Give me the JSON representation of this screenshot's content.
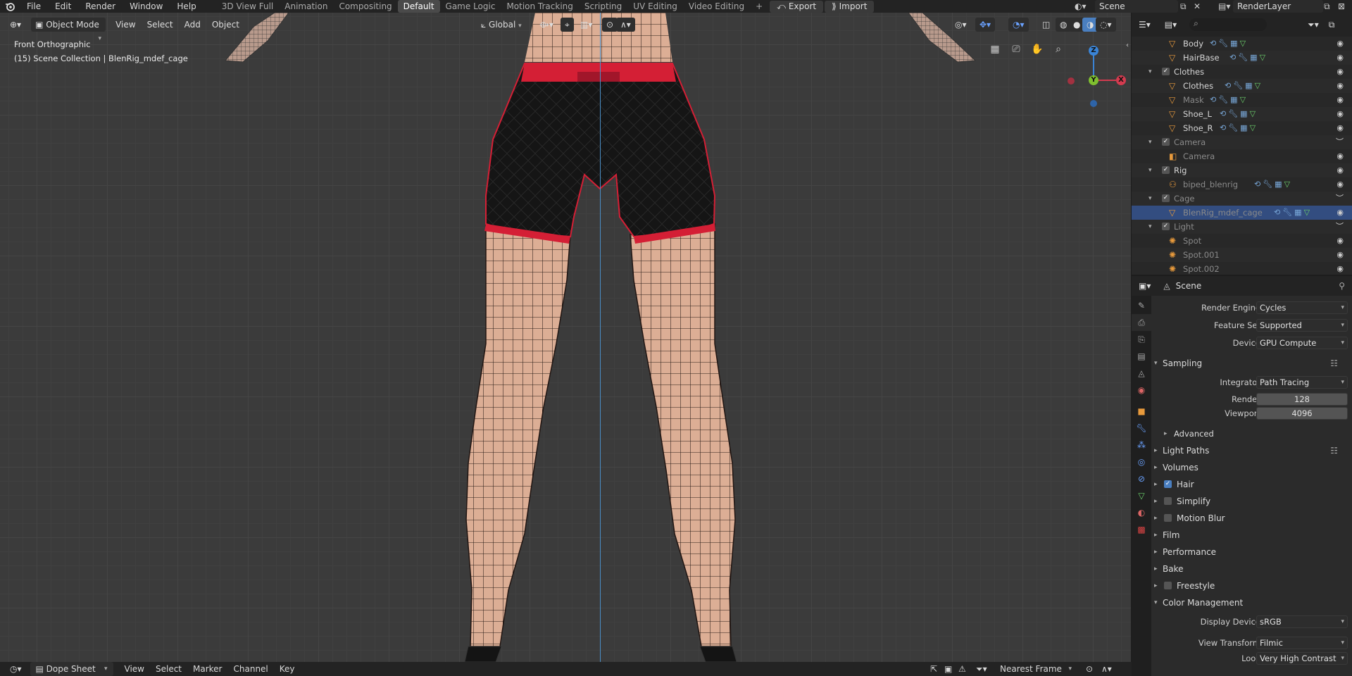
{
  "topbar": {
    "menus": [
      "File",
      "Edit",
      "Render",
      "Window",
      "Help"
    ],
    "workspaces": [
      "3D View Full",
      "Animation",
      "Compositing",
      "Default",
      "Game Logic",
      "Motion Tracking",
      "Scripting",
      "UV Editing",
      "Video Editing"
    ],
    "active_workspace": "Default",
    "add_tab": "+",
    "export_label": "Export",
    "import_label": "Import",
    "scene": "Scene",
    "view_layer": "RenderLayer"
  },
  "viewport": {
    "mode": "Object Mode",
    "menus": [
      "View",
      "Select",
      "Add",
      "Object"
    ],
    "transform_orientation": "Global",
    "view_name": "Front Orthographic",
    "collection_info": "(15) Scene Collection | BlenRig_mdef_cage",
    "gizmo": {
      "z": "Z",
      "y": "Y",
      "x": "X"
    },
    "colors": {
      "x_axis": "#d33b4f",
      "y_axis": "#7fbf2f",
      "z_axis": "#3a84d6",
      "center_line": "#4a8fc7",
      "shorts_trim": "#d41f35"
    }
  },
  "outliner": {
    "search_placeholder": "",
    "rows": [
      {
        "name": "Body",
        "type": "mesh",
        "level": 2,
        "mods": true,
        "dim": false
      },
      {
        "name": "HairBase",
        "type": "mesh",
        "level": 2,
        "mods": true,
        "dim": false
      },
      {
        "name": "Clothes",
        "type": "collection",
        "level": 1,
        "checked": true,
        "dim": false
      },
      {
        "name": "Clothes",
        "type": "mesh",
        "level": 2,
        "mods": true,
        "dim": false
      },
      {
        "name": "Mask",
        "type": "mesh",
        "level": 2,
        "mods": true,
        "dim": true
      },
      {
        "name": "Shoe_L",
        "type": "mesh",
        "level": 2,
        "mods": true,
        "dim": false
      },
      {
        "name": "Shoe_R",
        "type": "mesh",
        "level": 2,
        "mods": true,
        "dim": false
      },
      {
        "name": "Camera",
        "type": "collection",
        "level": 1,
        "checked": true,
        "dim": true
      },
      {
        "name": "Camera",
        "type": "camera",
        "level": 2,
        "mods": false,
        "dim": true
      },
      {
        "name": "Rig",
        "type": "collection",
        "level": 1,
        "checked": true,
        "dim": false
      },
      {
        "name": "biped_blenrig",
        "type": "armature",
        "level": 2,
        "mods": true,
        "dim": true
      },
      {
        "name": "Cage",
        "type": "collection",
        "level": 1,
        "checked": true,
        "dim": true
      },
      {
        "name": "BlenRig_mdef_cage",
        "type": "mesh",
        "level": 2,
        "mods": true,
        "dim": true,
        "selected": true
      },
      {
        "name": "Light",
        "type": "collection",
        "level": 1,
        "checked": true,
        "dim": true
      },
      {
        "name": "Spot",
        "type": "light",
        "level": 2,
        "mods": false,
        "dim": true
      },
      {
        "name": "Spot.001",
        "type": "light",
        "level": 2,
        "mods": false,
        "dim": true
      },
      {
        "name": "Spot.002",
        "type": "light",
        "level": 2,
        "mods": false,
        "dim": true
      }
    ]
  },
  "properties": {
    "context": "Scene",
    "render_engine_label": "Render Engine",
    "render_engine": "Cycles",
    "feature_set_label": "Feature Set",
    "feature_set": "Supported",
    "device_label": "Device",
    "device": "GPU Compute",
    "sampling": "Sampling",
    "integrator_label": "Integrator",
    "integrator": "Path Tracing",
    "render_label": "Render",
    "render_samples": "128",
    "viewport_label": "Viewport",
    "viewport_samples": "4096",
    "advanced": "Advanced",
    "light_paths": "Light Paths",
    "volumes": "Volumes",
    "hair": "Hair",
    "hair_checked": true,
    "simplify": "Simplify",
    "motion_blur": "Motion Blur",
    "film": "Film",
    "performance": "Performance",
    "bake": "Bake",
    "freestyle": "Freestyle",
    "color_management": "Color Management",
    "display_device_label": "Display Device",
    "display_device": "sRGB",
    "view_transform_label": "View Transform",
    "view_transform": "Filmic",
    "look_label": "Look",
    "look": "Very High Contrast"
  },
  "bottom": {
    "editor": "Dope Sheet",
    "menus": [
      "View",
      "Select",
      "Marker",
      "Channel",
      "Key"
    ],
    "snap": "Nearest Frame"
  }
}
